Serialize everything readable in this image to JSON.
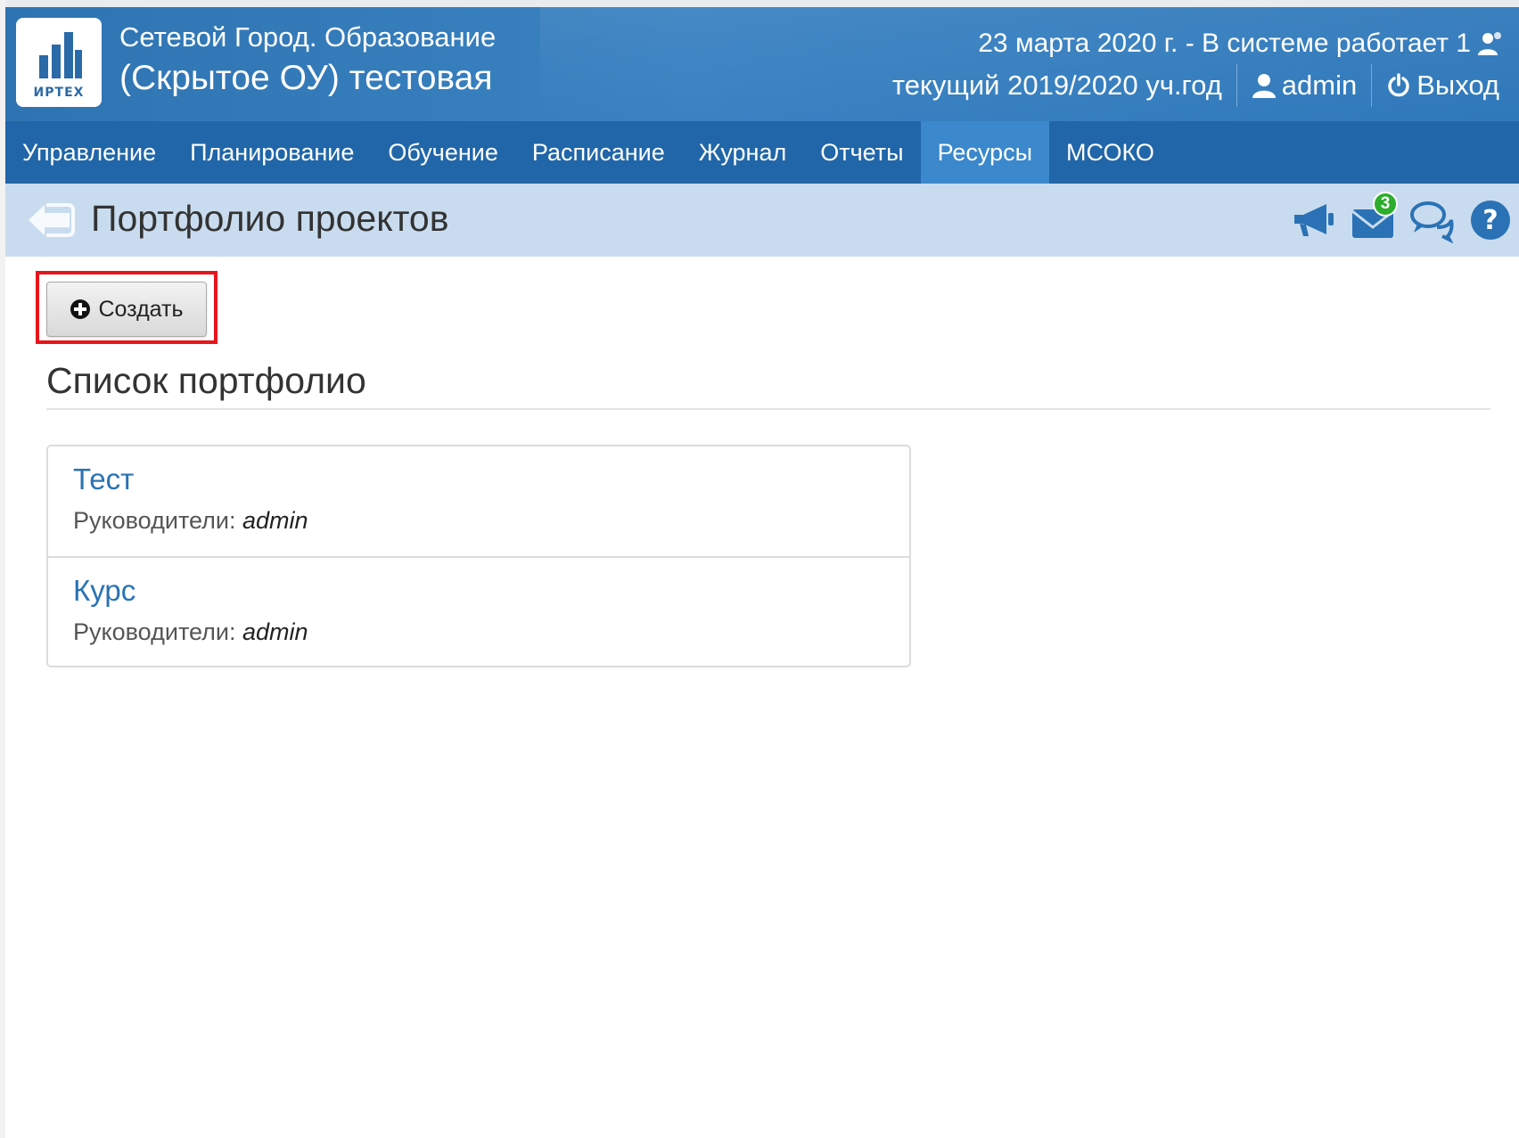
{
  "header": {
    "logo_text": "ИРТЕХ",
    "app_title": "Сетевой Город. Образование",
    "school_name": "(Скрытое ОУ) тестовая",
    "status_text": "23 марта 2020 г. - В системе работает 1",
    "school_year": "текущий 2019/2020 уч.год",
    "username": "admin",
    "logout_label": "Выход"
  },
  "nav": {
    "items": [
      {
        "label": "Управление"
      },
      {
        "label": "Планирование"
      },
      {
        "label": "Обучение"
      },
      {
        "label": "Расписание"
      },
      {
        "label": "Журнал"
      },
      {
        "label": "Отчеты"
      },
      {
        "label": "Ресурсы",
        "active": true
      },
      {
        "label": "МСОКО"
      }
    ]
  },
  "titlebar": {
    "title": "Портфолио проектов",
    "mail_badge_count": "3",
    "icons": [
      "back-icon",
      "megaphone-icon",
      "mail-icon",
      "chat-icon",
      "help-icon"
    ]
  },
  "main": {
    "create_button_label": "Создать",
    "section_heading": "Список портфолио",
    "portfolios": [
      {
        "title": "Тест",
        "leaders_label": "Руководители:",
        "leaders_value": "admin"
      },
      {
        "title": "Курс",
        "leaders_label": "Руководители:",
        "leaders_value": "admin"
      }
    ]
  },
  "colors": {
    "header_blue": "#2f74b2",
    "nav_blue": "#2166a8",
    "nav_active": "#3b88cc",
    "titlebar_bg": "#c9dcef",
    "link_blue": "#2a72b5",
    "highlight_red": "#e8141b",
    "badge_green": "#2cae2c"
  }
}
